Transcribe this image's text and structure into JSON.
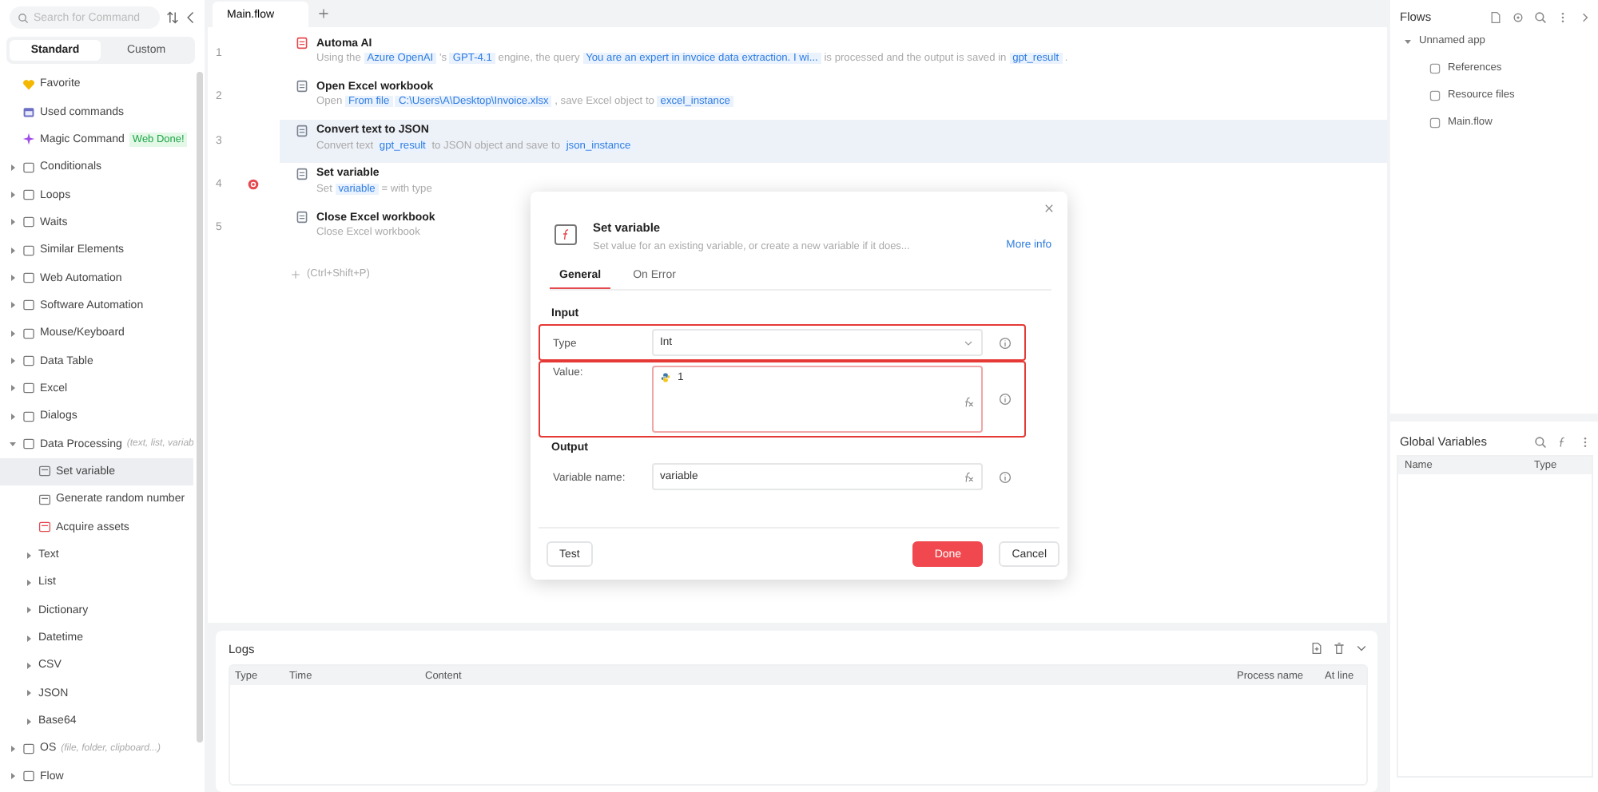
{
  "sidebar": {
    "search": {
      "placeholder": "Search for Command"
    },
    "tabs": [
      {
        "label": "Standard",
        "selected": true
      },
      {
        "label": "Custom",
        "selected": false
      }
    ],
    "items": [
      {
        "label": "Favorite",
        "kind": "shortcut",
        "selected": false
      },
      {
        "label": "Used commands",
        "kind": "shortcut",
        "selected": false
      },
      {
        "label": "Magic Command",
        "kind": "shortcut",
        "selected": false,
        "badge": "Web Done!"
      },
      {
        "label": "Conditionals",
        "kind": "group",
        "expanded": false
      },
      {
        "label": "Loops",
        "kind": "group",
        "expanded": false
      },
      {
        "label": "Waits",
        "kind": "group",
        "expanded": false
      },
      {
        "label": "Similar Elements",
        "kind": "group",
        "expanded": false
      },
      {
        "label": "Web Automation",
        "kind": "group",
        "expanded": false
      },
      {
        "label": "Software Automation",
        "kind": "group",
        "expanded": false
      },
      {
        "label": "Mouse/Keyboard",
        "kind": "group",
        "expanded": false
      },
      {
        "label": "Data Table",
        "kind": "group",
        "expanded": false
      },
      {
        "label": "Excel",
        "kind": "group",
        "expanded": false
      },
      {
        "label": "Dialogs",
        "kind": "group",
        "expanded": false
      },
      {
        "label": "Data Processing",
        "kind": "group",
        "expanded": true,
        "hint": "(text, list, variab",
        "children": [
          {
            "label": "Set variable",
            "kind": "action",
            "selected": true
          },
          {
            "label": "Generate random number",
            "kind": "action",
            "selected": false
          },
          {
            "label": "Acquire assets",
            "kind": "action",
            "selected": false
          },
          {
            "label": "Text",
            "kind": "subgroup",
            "expanded": false
          },
          {
            "label": "List",
            "kind": "subgroup",
            "expanded": false
          },
          {
            "label": "Dictionary",
            "kind": "subgroup",
            "expanded": false
          },
          {
            "label": "Datetime",
            "kind": "subgroup",
            "expanded": false
          },
          {
            "label": "CSV",
            "kind": "subgroup",
            "expanded": false
          },
          {
            "label": "JSON",
            "kind": "subgroup",
            "expanded": false
          },
          {
            "label": "Base64",
            "kind": "subgroup",
            "expanded": false
          }
        ]
      },
      {
        "label": "OS",
        "kind": "group",
        "expanded": false,
        "hint": "(file, folder, clipboard...)"
      },
      {
        "label": "Flow",
        "kind": "group",
        "expanded": false
      }
    ]
  },
  "editor": {
    "tabs": [
      {
        "label": "Main.flow",
        "selected": true
      }
    ],
    "steps": [
      {
        "number": "1",
        "title": "Automa AI",
        "selected": false,
        "error": false,
        "parts": [
          {
            "kind": "plain",
            "text": "Using the"
          },
          {
            "kind": "token",
            "text": "Azure OpenAI"
          },
          {
            "kind": "plain",
            "text": "'s"
          },
          {
            "kind": "token",
            "text": "GPT-4.1"
          },
          {
            "kind": "plain",
            "text": "engine, the query"
          },
          {
            "kind": "token",
            "text": "You are an expert in invoice data extraction. I wi..."
          },
          {
            "kind": "plain",
            "text": "is processed and the output is saved in"
          },
          {
            "kind": "token",
            "text": "gpt_result"
          },
          {
            "kind": "plain",
            "text": "."
          }
        ]
      },
      {
        "number": "2",
        "title": "Open Excel workbook",
        "selected": false,
        "error": false,
        "parts": [
          {
            "kind": "plain",
            "text": "Open"
          },
          {
            "kind": "token",
            "text": "From file"
          },
          {
            "kind": "token",
            "text": "C:\\Users\\A\\Desktop\\Invoice.xlsx"
          },
          {
            "kind": "plain",
            "text": ", save Excel object to"
          },
          {
            "kind": "token",
            "text": "excel_instance"
          }
        ]
      },
      {
        "number": "3",
        "title": "Convert text to JSON",
        "selected": true,
        "error": false,
        "parts": [
          {
            "kind": "plain",
            "text": "Convert text"
          },
          {
            "kind": "token",
            "text": "gpt_result"
          },
          {
            "kind": "plain",
            "text": "to JSON object and save to"
          },
          {
            "kind": "token",
            "text": "json_instance"
          }
        ]
      },
      {
        "number": "4",
        "title": "Set variable",
        "selected": false,
        "error": true,
        "parts": [
          {
            "kind": "plain",
            "text": "Set"
          },
          {
            "kind": "token",
            "text": "variable"
          },
          {
            "kind": "plain",
            "text": "= with type"
          }
        ]
      },
      {
        "number": "5",
        "title": "Close Excel workbook",
        "selected": false,
        "error": false,
        "parts": [
          {
            "kind": "plain",
            "text": "Close Excel workbook"
          }
        ]
      }
    ],
    "add_hint": "(Ctrl+Shift+P)"
  },
  "logs": {
    "title": "Logs",
    "columns": [
      "Type",
      "Time",
      "Content",
      "Process name",
      "At line"
    ]
  },
  "flows": {
    "title": "Flows",
    "tree": [
      {
        "label": "Unnamed app",
        "expanded": true,
        "children": [
          {
            "label": "References"
          },
          {
            "label": "Resource files"
          },
          {
            "label": "Main.flow"
          }
        ]
      }
    ]
  },
  "global_variables": {
    "title": "Global Variables",
    "columns": [
      "Name",
      "Type"
    ]
  },
  "dialog": {
    "title": "Set variable",
    "description": "Set value for an existing variable, or create a new variable if it does...",
    "link": "More info",
    "tabs": [
      {
        "label": "General",
        "selected": true
      },
      {
        "label": "On Error",
        "selected": false
      }
    ],
    "sections": [
      {
        "title": "Input",
        "fields": [
          {
            "kind": "select",
            "label": "Type",
            "value": "Int",
            "highlighted": true
          },
          {
            "kind": "textarea",
            "label": "Value:",
            "value": "1",
            "highlighted": true
          }
        ]
      },
      {
        "title": "Output",
        "fields": [
          {
            "kind": "input",
            "label": "Variable name:",
            "value": "variable",
            "highlighted": false
          }
        ]
      }
    ],
    "buttons": [
      {
        "label": "Test",
        "kind": "plain"
      },
      {
        "label": "Done",
        "kind": "primary"
      },
      {
        "label": "Cancel",
        "kind": "plain"
      }
    ]
  }
}
